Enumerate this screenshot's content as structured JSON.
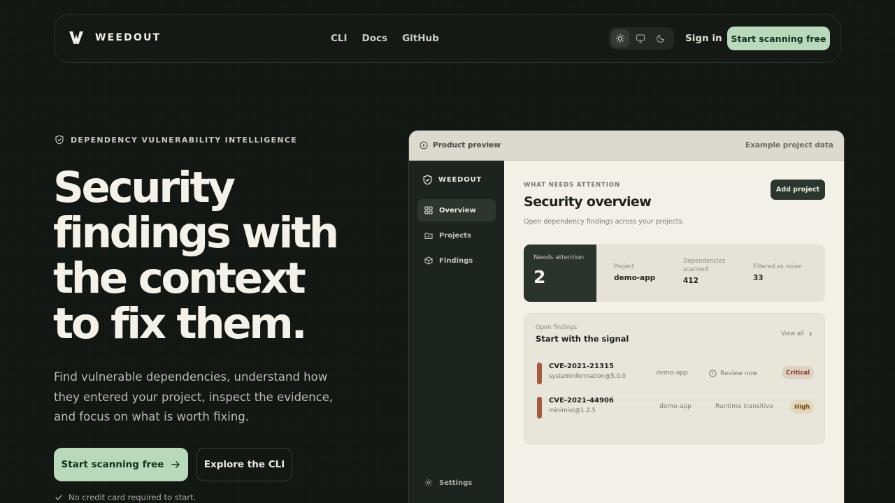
{
  "nav": {
    "brand": "WEEDOUT",
    "links": [
      "CLI",
      "Docs",
      "GitHub"
    ],
    "theme_icons": [
      "sun-icon",
      "monitor-icon",
      "moon-icon"
    ],
    "sign_in": "Sign in",
    "cta": "Start scanning free"
  },
  "hero": {
    "eyebrow": "DEPENDENCY VULNERABILITY INTELLIGENCE",
    "headline": [
      "Security",
      "findings with",
      "the context",
      "to fix them."
    ],
    "subtitle": "Find vulnerable dependencies, understand how they entered your project, inspect the evidence, and focus on what is worth fixing.",
    "primary_cta": "Start scanning free",
    "secondary_cta": "Explore the CLI",
    "note": "No credit card required to start."
  },
  "preview": {
    "top_left": "Product preview",
    "top_right": "Example project data",
    "sidebar": {
      "brand": "WEEDOUT",
      "items": [
        "Overview",
        "Projects",
        "Findings"
      ],
      "settings": "Settings"
    },
    "main": {
      "eyebrow": "WHAT NEEDS ATTENTION",
      "title": "Security overview",
      "subtitle": "Open dependency findings across your projects.",
      "add_button": "Add project",
      "stats": {
        "needs_label": "Needs attention",
        "needs_value": "2",
        "project_label": "Project",
        "project_value": "demo-app",
        "deps_label": "Dependencies scanned",
        "deps_value": "412",
        "noise_label": "Filtered as noise",
        "noise_value": "33"
      },
      "findings": {
        "label": "Open findings",
        "title": "Start with the signal",
        "view_all": "View all",
        "rows": [
          {
            "cve": "CVE-2021-21315",
            "pkg": "systeminformation@5.0.0",
            "project": "demo-app",
            "status": "Review now",
            "severity": "Critical"
          },
          {
            "cve": "CVE-2021-44906",
            "pkg": "minimist@1.2.5",
            "project": "demo-app",
            "status": "Runtime transitive",
            "severity": "High"
          }
        ]
      }
    }
  },
  "colors": {
    "background": "#121613",
    "accent": "#b8d9ba",
    "critical": "#a3593e"
  }
}
